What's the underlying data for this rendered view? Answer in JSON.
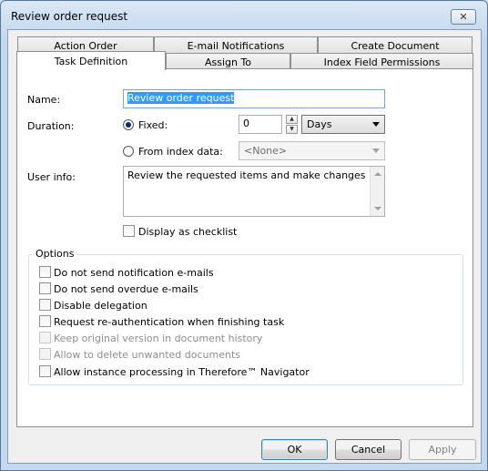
{
  "window": {
    "title": "Review order request",
    "close_glyph": "✕"
  },
  "tabs": {
    "row_top": [
      "Action Order",
      "E-mail Notifications",
      "Create Document"
    ],
    "row_bottom": [
      "Task Definition",
      "Assign To",
      "Index Field Permissions"
    ],
    "active": "Task Definition"
  },
  "form": {
    "name_label": "Name:",
    "name_value": "Review order request",
    "duration_label": "Duration:",
    "fixed_label": "Fixed:",
    "fixed_value": "0",
    "unit_value": "Days",
    "from_index_label": "From index data:",
    "index_value": "<None>",
    "user_info_label": "User info:",
    "user_info_value": "Review the requested items and make changes if nece",
    "display_checklist_label": "Display as checklist"
  },
  "options": {
    "title": "Options",
    "items": [
      {
        "label": "Do not send notification e-mails",
        "enabled": true,
        "checked": false
      },
      {
        "label": "Do not send overdue e-mails",
        "enabled": true,
        "checked": false
      },
      {
        "label": "Disable delegation",
        "enabled": true,
        "checked": false
      },
      {
        "label": "Request re-authentication when finishing task",
        "enabled": true,
        "checked": false
      },
      {
        "label": "Keep original version in document history",
        "enabled": false,
        "checked": false
      },
      {
        "label": "Allow to delete unwanted documents",
        "enabled": false,
        "checked": false
      },
      {
        "label": "Allow instance processing in Therefore™ Navigator",
        "enabled": true,
        "checked": false
      }
    ]
  },
  "buttons": {
    "ok": "OK",
    "cancel": "Cancel",
    "apply": "Apply"
  },
  "icons": {
    "spin_up": "▲",
    "spin_down": "▼",
    "combo_arrow": "chevron-down-icon",
    "scroll_up": "scroll-up-icon",
    "scroll_down": "scroll-down-icon"
  },
  "colors": {
    "selection": "#3399ff",
    "title_bar": "#c4d8ee",
    "focus_border": "#7da2ce"
  }
}
